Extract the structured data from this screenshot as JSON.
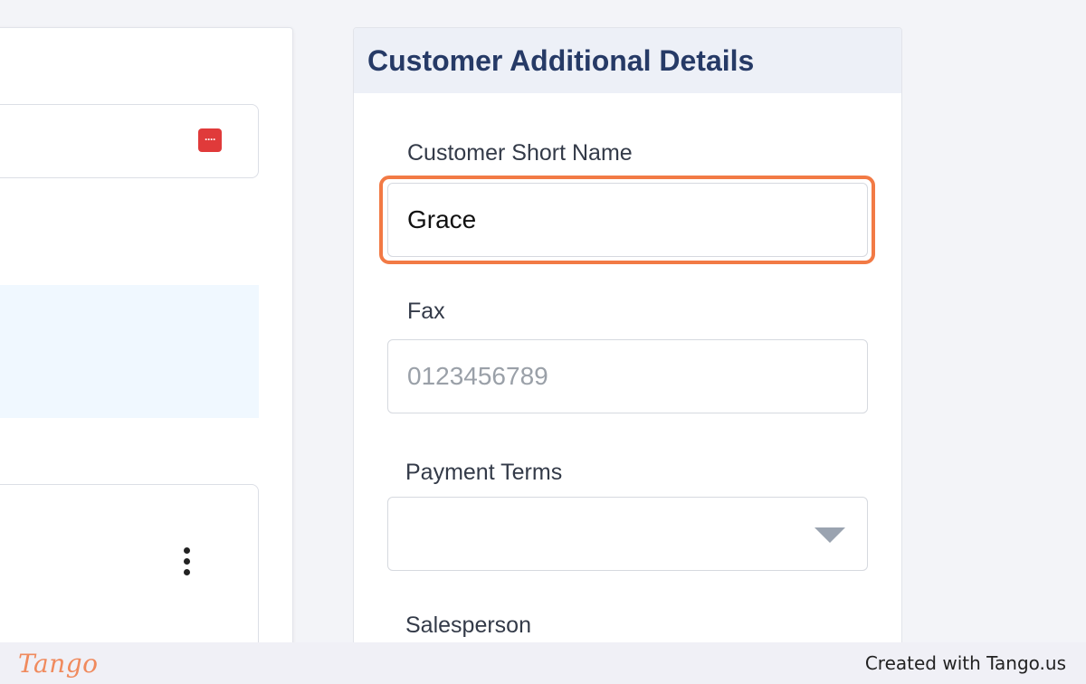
{
  "right_panel": {
    "title": "Customer Additional Details",
    "fields": {
      "short_name": {
        "label": "Customer Short Name",
        "value": "Grace"
      },
      "fax": {
        "label": "Fax",
        "placeholder": "0123456789"
      },
      "payment_terms": {
        "label": "Payment Terms",
        "value": ""
      },
      "salesperson": {
        "label": "Salesperson"
      }
    }
  },
  "left_panel": {
    "field_icon": "password-manager-icon",
    "menu_icon": "kebab-menu-icon"
  },
  "footer": {
    "logo_text": "Tango",
    "credit_text": "Created with Tango.us"
  },
  "colors": {
    "focus_ring": "#f27a45",
    "header_text": "#263a66",
    "header_bg": "#edf0f7",
    "icon_red": "#e03a3a",
    "tango_orange": "#f08a5d"
  }
}
